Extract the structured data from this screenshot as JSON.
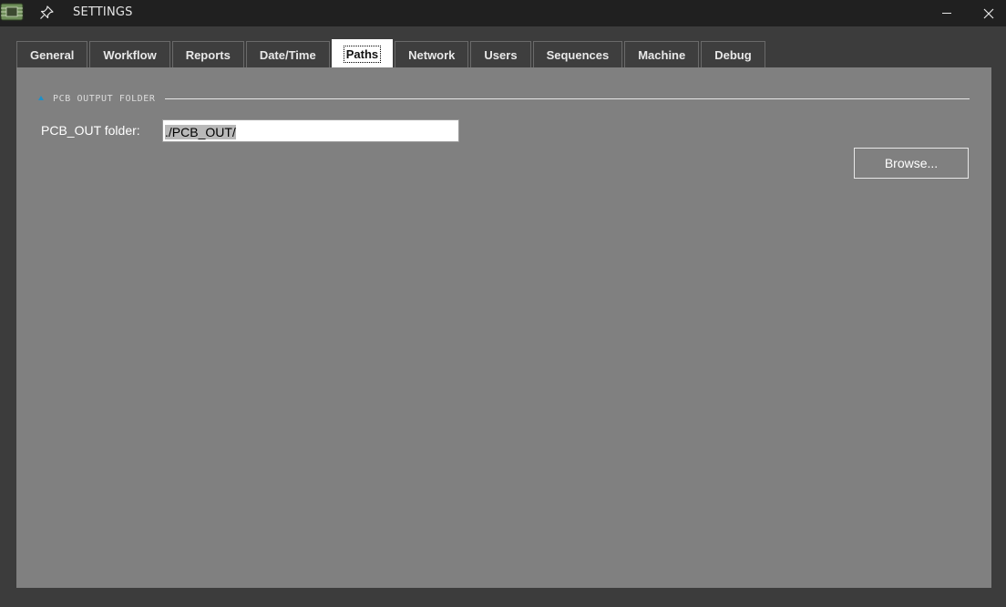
{
  "window": {
    "title": "SETTINGS",
    "app_icon": "circuit-board-icon",
    "pin_icon": "pin-icon",
    "minimize_icon": "minimize-icon",
    "close_icon": "close-icon"
  },
  "tabs": [
    {
      "label": "General",
      "active": false
    },
    {
      "label": "Workflow",
      "active": false
    },
    {
      "label": "Reports",
      "active": false
    },
    {
      "label": "Date/Time",
      "active": false
    },
    {
      "label": "Paths",
      "active": true
    },
    {
      "label": "Network",
      "active": false
    },
    {
      "label": "Users",
      "active": false
    },
    {
      "label": "Sequences",
      "active": false
    },
    {
      "label": "Machine",
      "active": false
    },
    {
      "label": "Debug",
      "active": false
    }
  ],
  "paths": {
    "section_title": "PCB OUTPUT FOLDER",
    "field_label": "PCB_OUT folder:",
    "field_value": "./PCB_OUT/",
    "browse_label": "Browse..."
  },
  "colors": {
    "titlebar": "#202020",
    "window_bg": "#3c3c3c",
    "panel_bg": "#808080",
    "collapse_accent": "#1e90c8"
  }
}
